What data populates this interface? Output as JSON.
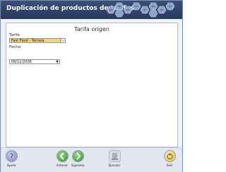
{
  "header": {
    "title": "Duplicación de productos de tarifas."
  },
  "section": {
    "title": "Tarifa origen"
  },
  "fields": {
    "tarifa_label": "Tarifa",
    "tarifa_value": "Fast Food - Terraza",
    "fecha_label": "Fecha",
    "fecha_value": "09/11/2006"
  },
  "footer": {
    "help": "Ayuda",
    "previous": "Anterior",
    "next": "Siguiente",
    "execute": "Ejecutar",
    "exit": "Salir"
  },
  "colors": {
    "header_bg": "#2f4470",
    "selected_field": "#f6d66e",
    "nav_green": "#3fa33a"
  }
}
